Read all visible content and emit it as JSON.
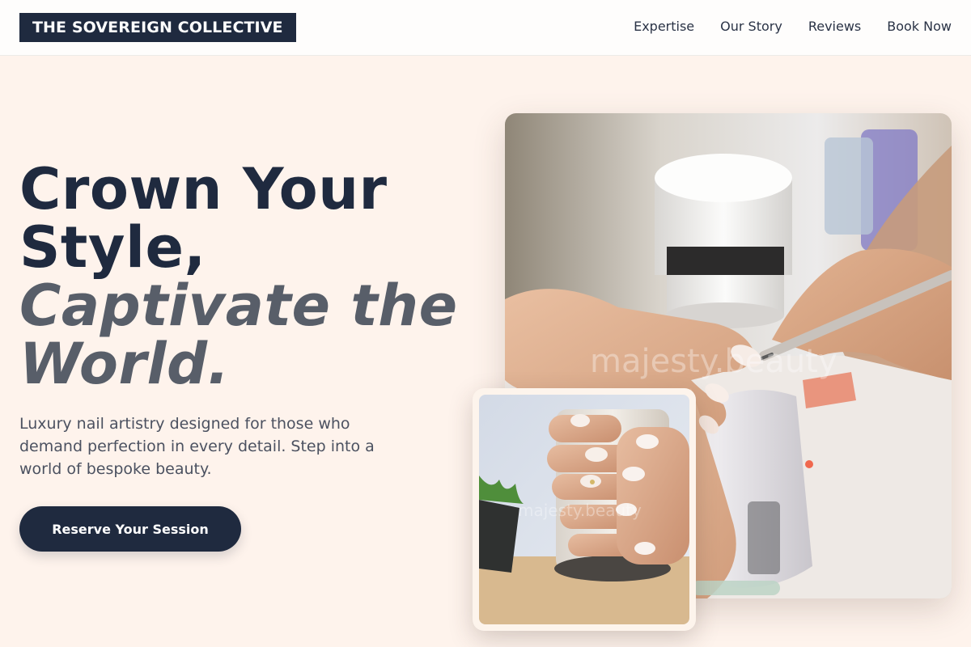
{
  "header": {
    "brand": "THE SOVEREIGN COLLECTIVE",
    "nav": [
      "Expertise",
      "Our Story",
      "Reviews",
      "Book Now"
    ]
  },
  "hero": {
    "title_line1": "Crown Your",
    "title_line2": "Style,",
    "title_accent_line1": "Captivate the",
    "title_accent_line2": "World.",
    "subtitle": "Luxury nail artistry designed for those who demand perfection in every detail. Step into a world of bespoke beauty.",
    "cta_label": "Reserve Your Session"
  },
  "images": {
    "main_watermark": "majesty.beauty",
    "inset_watermark": "majesty.beauty"
  },
  "colors": {
    "background": "#fef3ec",
    "navy": "#1f2a3f",
    "accent_gray": "#585e69"
  }
}
